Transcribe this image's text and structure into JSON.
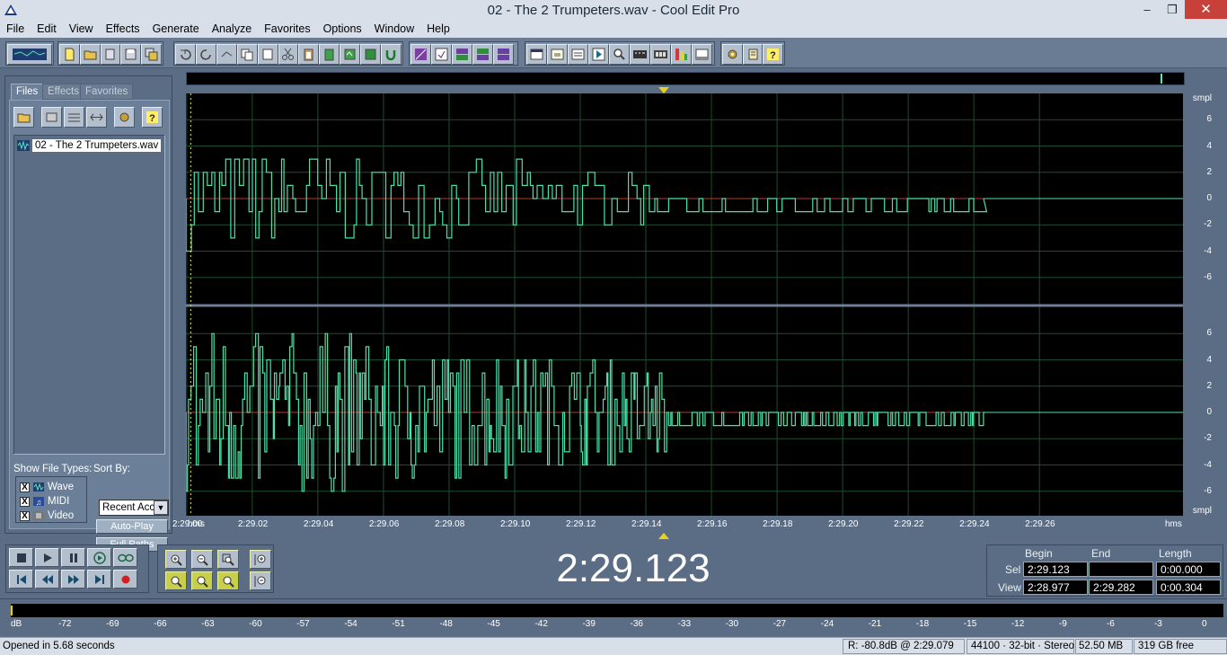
{
  "window": {
    "title": "02 - The 2 Trumpeters.wav - Cool Edit Pro"
  },
  "menu": [
    "File",
    "Edit",
    "View",
    "Effects",
    "Generate",
    "Analyze",
    "Favorites",
    "Options",
    "Window",
    "Help"
  ],
  "left_panel": {
    "tabs": {
      "files": "Files",
      "effects": "Effects",
      "favorites": "Favorites"
    },
    "files": [
      "02 - The 2 Trumpeters.wav"
    ],
    "show_file_types_label": "Show File Types:",
    "sort_by_label": "Sort By:",
    "file_types": [
      {
        "label": "Wave",
        "checked": true
      },
      {
        "label": "MIDI",
        "checked": true
      },
      {
        "label": "Video",
        "checked": true
      }
    ],
    "sort_value": "Recent Access",
    "auto_play": "Auto-Play",
    "full_paths": "Full Paths"
  },
  "waveform": {
    "colors": {
      "wave": "#4ee0a8",
      "grid": "#1d4d2e",
      "zero": "#b83a2a",
      "cursor": "#e8e860"
    },
    "units": "smpl",
    "amp_labels_top": [
      "6",
      "4",
      "2",
      "0",
      "-2",
      "-4",
      "-6"
    ],
    "amp_labels_bottom": [
      "6",
      "4",
      "2",
      "0",
      "-2",
      "-4",
      "-6"
    ],
    "time_unit": "hms",
    "time_labels": [
      "2:29.00",
      "2:29.02",
      "2:29.04",
      "2:29.06",
      "2:29.08",
      "2:29.10",
      "2:29.12",
      "2:29.14",
      "2:29.16",
      "2:29.18",
      "2:29.20",
      "2:29.22",
      "2:29.24",
      "2:29.26"
    ],
    "cursor_time": "2:29.123",
    "view_start": 2.28977,
    "view_length": 0.304,
    "signal_end_fraction": 0.8
  },
  "time_display": "2:29.123",
  "selection": {
    "headers": {
      "begin": "Begin",
      "end": "End",
      "length": "Length"
    },
    "sel_label": "Sel",
    "view_label": "View",
    "sel": {
      "begin": "2:29.123",
      "end": "",
      "length": "0:00.000"
    },
    "view": {
      "begin": "2:28.977",
      "end": "2:29.282",
      "length": "0:00.304"
    }
  },
  "level_meter": {
    "labels": [
      "dB",
      "-72",
      "-69",
      "-66",
      "-63",
      "-60",
      "-57",
      "-54",
      "-51",
      "-48",
      "-45",
      "-42",
      "-39",
      "-36",
      "-33",
      "-30",
      "-27",
      "-24",
      "-21",
      "-18",
      "-15",
      "-12",
      "-9",
      "-6",
      "-3",
      "0"
    ]
  },
  "status": {
    "message": "Opened in 5.68 seconds",
    "cursor_info": "R: -80.8dB @  2:29.079",
    "format": "44100 · 32-bit · Stereo",
    "size": "52.50 MB",
    "free": "319 GB free"
  }
}
